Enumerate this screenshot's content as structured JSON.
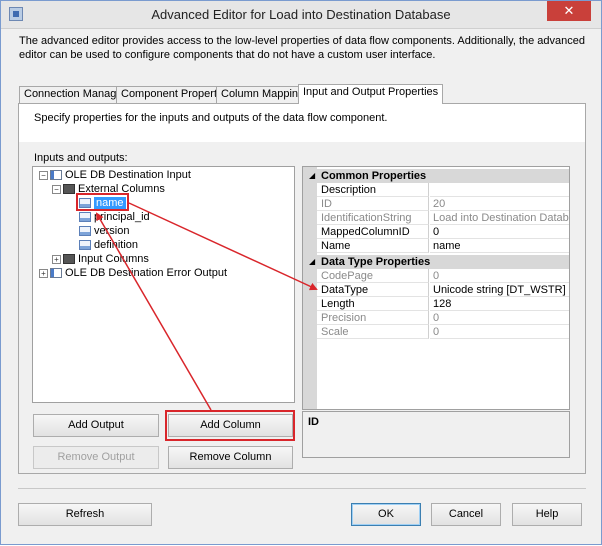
{
  "window": {
    "title": "Advanced Editor for Load into Destination Database",
    "close_glyph": "✕"
  },
  "intro_text": "The advanced editor provides access to the low-level properties of data flow components. Additionally, the advanced editor can be used to configure components that do not have a custom user interface.",
  "tabs": [
    {
      "label": "Connection Managers"
    },
    {
      "label": "Component Properties"
    },
    {
      "label": "Column Mappings"
    },
    {
      "label": "Input and Output Properties",
      "active": true
    }
  ],
  "tab_description": "Specify properties for the inputs and outputs of the data flow component.",
  "inputs_outputs_label": "Inputs and outputs:",
  "tree": {
    "nodes": [
      {
        "label": "OLE DB Destination Input",
        "expander": "−",
        "icon": "io-icon"
      },
      {
        "label": "External Columns",
        "expander": "−",
        "icon": "folder-icon"
      },
      {
        "label": "name",
        "icon": "column-icon",
        "selected": true
      },
      {
        "label": "principal_id",
        "icon": "column-icon"
      },
      {
        "label": "version",
        "icon": "column-icon"
      },
      {
        "label": "definition",
        "icon": "column-icon"
      },
      {
        "label": "Input Columns",
        "expander": "+",
        "icon": "folder-icon"
      },
      {
        "label": "OLE DB Destination Error Output",
        "expander": "+",
        "icon": "io-icon"
      }
    ]
  },
  "properties": {
    "categories": [
      {
        "name": "Common Properties",
        "rows": [
          {
            "name": "Description",
            "value": ""
          },
          {
            "name": "ID",
            "value": "20",
            "dim": true
          },
          {
            "name": "IdentificationString",
            "value": "Load into Destination Database.Inp",
            "dim": true
          },
          {
            "name": "MappedColumnID",
            "value": "0"
          },
          {
            "name": "Name",
            "value": "name"
          }
        ]
      },
      {
        "name": "Data Type Properties",
        "rows": [
          {
            "name": "CodePage",
            "value": "0",
            "dim": true
          },
          {
            "name": "DataType",
            "value": "Unicode string [DT_WSTR]"
          },
          {
            "name": "Length",
            "value": "128"
          },
          {
            "name": "Precision",
            "value": "0",
            "dim": true
          },
          {
            "name": "Scale",
            "value": "0",
            "dim": true
          }
        ]
      }
    ],
    "description_title": "ID"
  },
  "buttons": {
    "add_output": "Add Output",
    "add_column": "Add Column",
    "remove_output": "Remove Output",
    "remove_column": "Remove Column",
    "refresh": "Refresh",
    "ok": "OK",
    "cancel": "Cancel",
    "help": "Help"
  },
  "colors": {
    "annotation_red": "#d9262b",
    "selection_blue": "#3399ff"
  }
}
